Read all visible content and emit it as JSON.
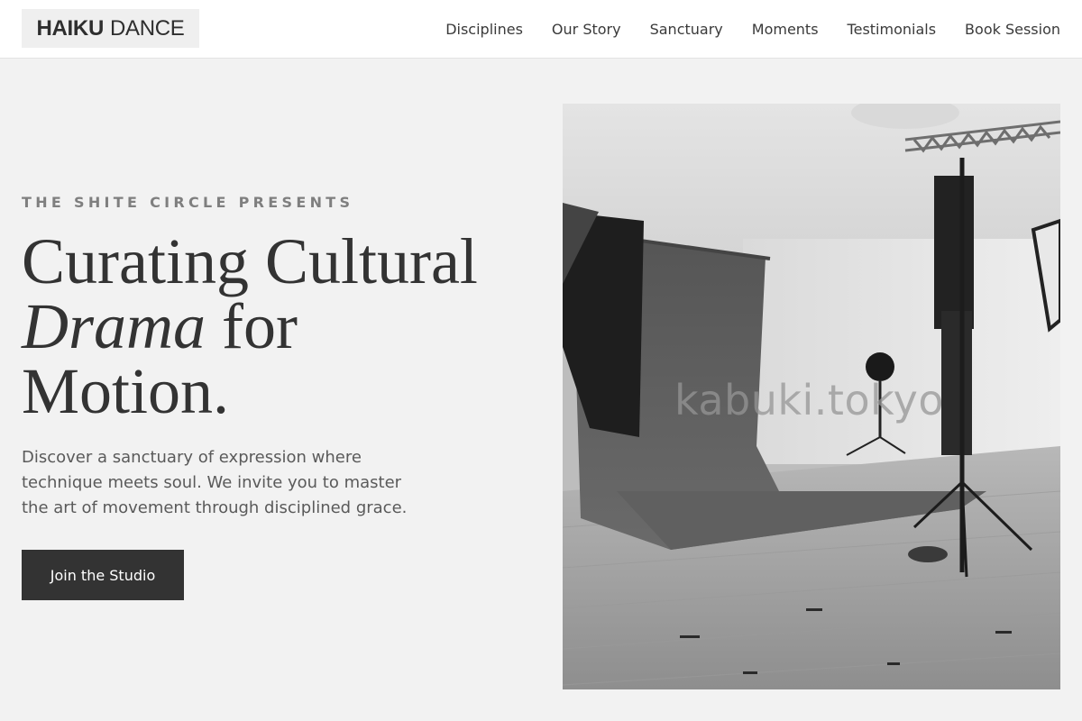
{
  "header": {
    "logo_bold": "HAIKU",
    "logo_light": "DANCE",
    "nav": [
      "Disciplines",
      "Our Story",
      "Sanctuary",
      "Moments",
      "Testimonials",
      "Book Session"
    ]
  },
  "hero": {
    "eyebrow": "THE SHITE CIRCLE PRESENTS",
    "headline_line1": "Curating Cultural",
    "headline_italic": "Drama",
    "headline_line2_rest": " for",
    "headline_line3": "Motion.",
    "lead": "Discover a sanctuary of expression where technique meets soul. We invite you to master the art of movement through disciplined grace.",
    "cta_label": "Join the Studio",
    "image_watermark": "kabuki.tokyo"
  },
  "colors": {
    "page_bg": "#f2f2f2",
    "header_bg": "#ffffff",
    "cta_bg": "#333333",
    "text_dark": "#333333",
    "eyebrow": "#7f7f7f"
  }
}
